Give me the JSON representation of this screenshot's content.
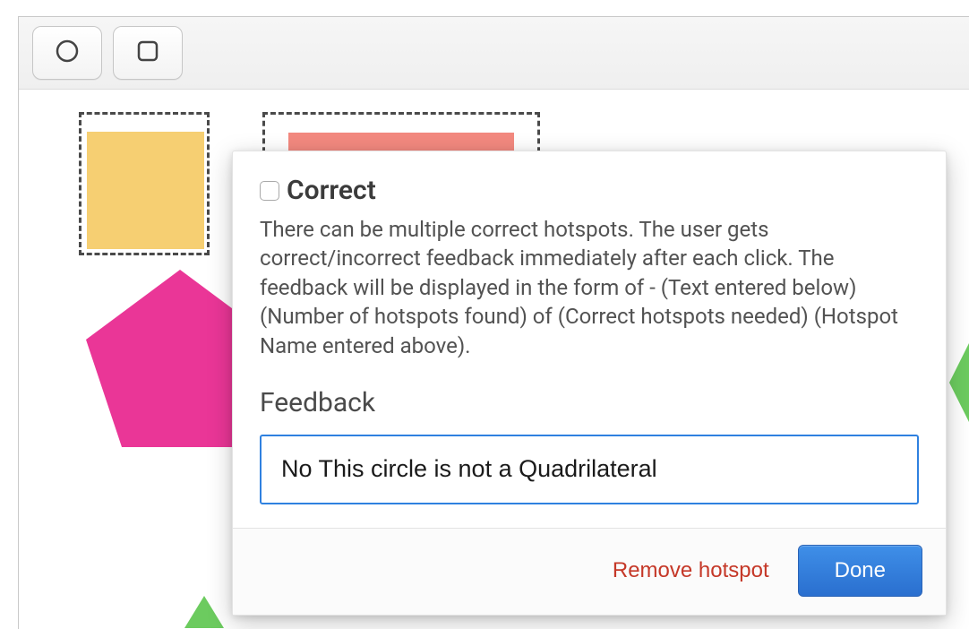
{
  "toolbar": {
    "circle_tool": "circle-tool",
    "rect_tool": "rectangle-tool"
  },
  "shapes": {
    "yellow_square": {
      "color": "#f6cf72"
    },
    "red_bar": {
      "color": "#f3897f"
    },
    "pentagon": {
      "color": "#ea3697"
    },
    "green_diamond": {
      "color": "#6CCB5F"
    },
    "green_triangle": {
      "color": "#6CCB5F"
    }
  },
  "popover": {
    "correct_label": "Correct",
    "help_text": "There can be multiple correct hotspots. The user gets correct/incorrect feedback immediately after each click. The feedback will be displayed in the form of - (Text entered below) (Number of hotspots found) of (Correct hotspots needed) (Hotspot Name entered above).",
    "feedback_heading": "Feedback",
    "feedback_value": "No This circle is not a Quadrilateral",
    "remove_label": "Remove hotspot",
    "done_label": "Done"
  }
}
